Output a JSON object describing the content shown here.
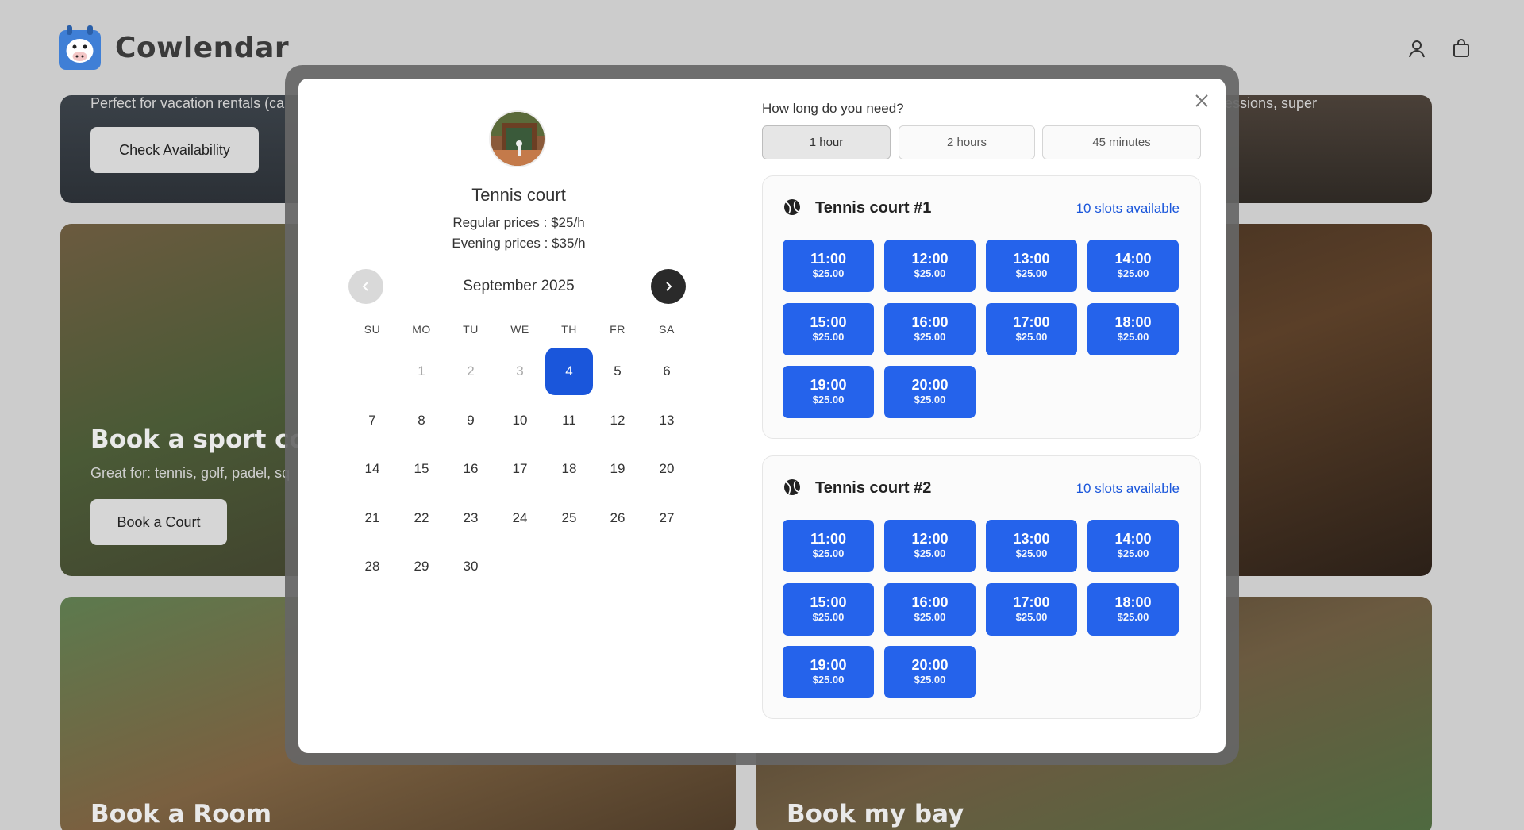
{
  "site": {
    "brand": "Cowlendar",
    "cards": {
      "top_left_sub": "Perfect for vacation rentals (ca",
      "top_left_button": "Check Availability",
      "top_right_sub": "essions, super",
      "sport_title": "Book a sport cour",
      "sport_sub": "Great for: tennis, golf, padel, sq",
      "sport_button": "Book a Court",
      "room_title": "Book a Room",
      "bay_title": "Book my bay"
    }
  },
  "modal": {
    "venue": {
      "title": "Tennis court",
      "regular_price": "Regular prices : $25/h",
      "evening_price": "Evening prices : $35/h"
    },
    "calendar": {
      "month": "September 2025",
      "weekdays": [
        "SU",
        "MO",
        "TU",
        "WE",
        "TH",
        "FR",
        "SA"
      ],
      "days": [
        "1",
        "2",
        "3",
        "4",
        "5",
        "6",
        "7",
        "8",
        "9",
        "10",
        "11",
        "12",
        "13",
        "14",
        "15",
        "16",
        "17",
        "18",
        "19",
        "20",
        "21",
        "22",
        "23",
        "24",
        "25",
        "26",
        "27",
        "28",
        "29",
        "30"
      ],
      "first_weekday_index": 1,
      "disabled_days": [
        "1",
        "2",
        "3"
      ],
      "selected_day": "4"
    },
    "duration": {
      "question": "How long do you need?",
      "options": [
        "1 hour",
        "2 hours",
        "45 minutes"
      ],
      "selected": "1 hour"
    },
    "courts": [
      {
        "name": "Tennis court #1",
        "availability": "10 slots available",
        "slots": [
          {
            "time": "11:00",
            "price": "$25.00"
          },
          {
            "time": "12:00",
            "price": "$25.00"
          },
          {
            "time": "13:00",
            "price": "$25.00"
          },
          {
            "time": "14:00",
            "price": "$25.00"
          },
          {
            "time": "15:00",
            "price": "$25.00"
          },
          {
            "time": "16:00",
            "price": "$25.00"
          },
          {
            "time": "17:00",
            "price": "$25.00"
          },
          {
            "time": "18:00",
            "price": "$25.00"
          },
          {
            "time": "19:00",
            "price": "$25.00"
          },
          {
            "time": "20:00",
            "price": "$25.00"
          }
        ]
      },
      {
        "name": "Tennis court #2",
        "availability": "10 slots available",
        "slots": [
          {
            "time": "11:00",
            "price": "$25.00"
          },
          {
            "time": "12:00",
            "price": "$25.00"
          },
          {
            "time": "13:00",
            "price": "$25.00"
          },
          {
            "time": "14:00",
            "price": "$25.00"
          },
          {
            "time": "15:00",
            "price": "$25.00"
          },
          {
            "time": "16:00",
            "price": "$25.00"
          },
          {
            "time": "17:00",
            "price": "$25.00"
          },
          {
            "time": "18:00",
            "price": "$25.00"
          },
          {
            "time": "19:00",
            "price": "$25.00"
          },
          {
            "time": "20:00",
            "price": "$25.00"
          }
        ]
      }
    ],
    "colors": {
      "accent": "#2563eb",
      "selected_day": "#1a56db"
    }
  }
}
